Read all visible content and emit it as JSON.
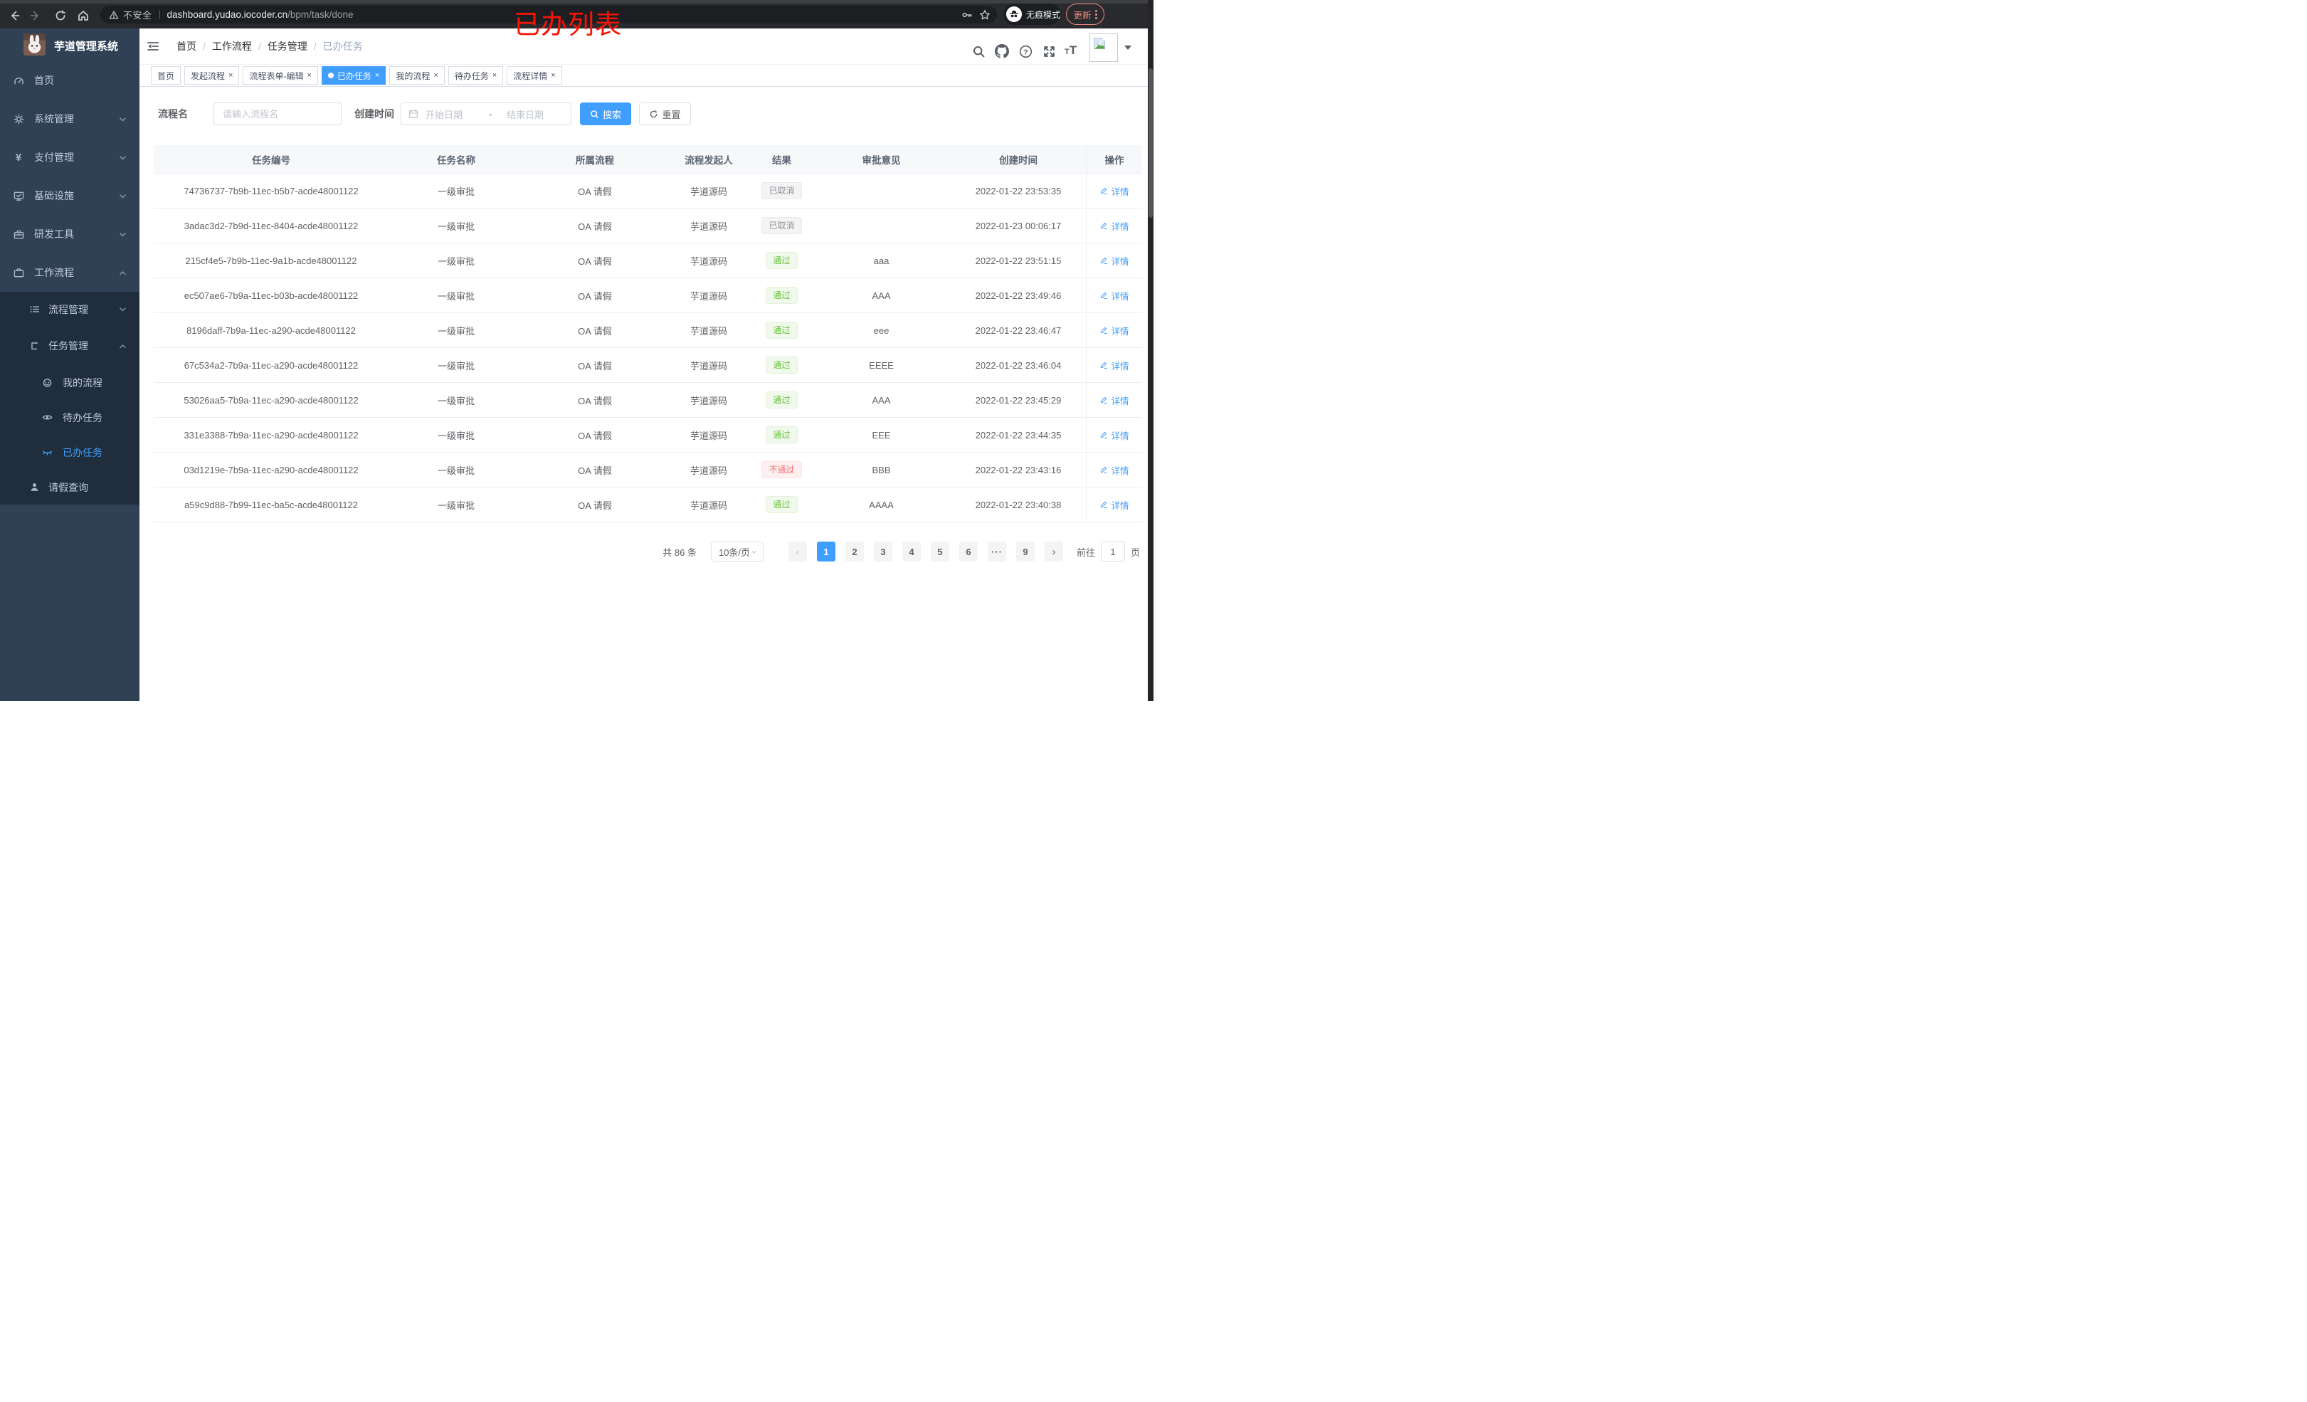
{
  "browser": {
    "security_label": "不安全",
    "url_host": "dashboard.yudao.iocoder.cn",
    "url_path": "/bpm/task/done",
    "incognito_label": "无痕模式",
    "update_label": "更新",
    "annotation_text": "已办列表",
    "annotation_color": "#fb1405",
    "nav_icons": [
      "back-icon",
      "forward-icon",
      "refresh-icon",
      "home-icon",
      "warning-icon",
      "key-icon",
      "star-icon",
      "incognito-icon",
      "kebab-menu-icon"
    ]
  },
  "sidebar": {
    "logo_title": "芋道管理系统",
    "items": [
      {
        "key": "home",
        "label": "首页",
        "icon": "dashboard",
        "level": 1,
        "group": "top"
      },
      {
        "key": "system",
        "label": "系统管理",
        "icon": "gear",
        "level": 1,
        "group": "top",
        "chevron": "down"
      },
      {
        "key": "payment",
        "label": "支付管理",
        "icon": "yen",
        "level": 1,
        "group": "top",
        "chevron": "down"
      },
      {
        "key": "infrastructure",
        "label": "基础设施",
        "icon": "monitor",
        "level": 1,
        "group": "top",
        "chevron": "down"
      },
      {
        "key": "devtools",
        "label": "研发工具",
        "icon": "toolbox",
        "level": 1,
        "group": "top",
        "chevron": "down"
      },
      {
        "key": "workflow",
        "label": "工作流程",
        "icon": "briefcase",
        "level": 1,
        "group": "top",
        "chevron": "up"
      },
      {
        "key": "process-mgmt",
        "label": "流程管理",
        "icon": "tree-list",
        "level": 2,
        "group": "sub",
        "chevron": "down"
      },
      {
        "key": "task-mgmt",
        "label": "任务管理",
        "icon": "flow",
        "level": 2,
        "group": "sub",
        "chevron": "up",
        "tall": true
      },
      {
        "key": "my-process",
        "label": "我的流程",
        "icon": "face",
        "level": 3,
        "group": "sub"
      },
      {
        "key": "todo-tasks",
        "label": "待办任务",
        "icon": "eye-open",
        "level": 3,
        "group": "sub"
      },
      {
        "key": "done-tasks",
        "label": "已办任务",
        "icon": "eye-closed",
        "level": 3,
        "group": "sub",
        "active": true
      },
      {
        "key": "leave-query",
        "label": "请假查询",
        "icon": "user",
        "level": 2,
        "group": "sub"
      }
    ]
  },
  "navbar": {
    "breadcrumb": [
      "首页",
      "工作流程",
      "任务管理",
      "已办任务"
    ],
    "separator": "/",
    "icons": [
      "hamburger-fold-icon",
      "search-icon",
      "github-icon",
      "question-icon",
      "fullscreen-icon",
      "text-size-icon",
      "avatar-placeholder",
      "caret-down-icon"
    ]
  },
  "tabs": [
    {
      "key": "home",
      "label": "首页",
      "closable": false,
      "active": false
    },
    {
      "key": "start-process",
      "label": "发起流程",
      "closable": true,
      "active": false
    },
    {
      "key": "form-edit",
      "label": "流程表单-编辑",
      "closable": true,
      "active": false
    },
    {
      "key": "done-tasks",
      "label": "已办任务",
      "closable": true,
      "active": true
    },
    {
      "key": "my-process",
      "label": "我的流程",
      "closable": true,
      "active": false
    },
    {
      "key": "todo-tasks",
      "label": "待办任务",
      "closable": true,
      "active": false
    },
    {
      "key": "process-detail",
      "label": "流程详情",
      "closable": true,
      "active": false
    }
  ],
  "filter": {
    "name_label": "流程名",
    "name_placeholder": "请输入流程名",
    "time_label": "创建时间",
    "start_placeholder": "开始日期",
    "range_separator": "-",
    "end_placeholder": "结束日期",
    "search_label": "搜索",
    "reset_label": "重置"
  },
  "table": {
    "columns": [
      "任务编号",
      "任务名称",
      "所属流程",
      "流程发起人",
      "结果",
      "审批意见",
      "创建时间",
      "操作"
    ],
    "action_label": "详情",
    "rows": [
      {
        "id": "74736737-7b9b-11ec-b5b7-acde48001122",
        "name": "一级审批",
        "process": "OA 请假",
        "starter": "芋道源码",
        "result": "已取消",
        "result_type": "info",
        "comment": "",
        "created": "2022-01-22 23:53:35"
      },
      {
        "id": "3adac3d2-7b9d-11ec-8404-acde48001122",
        "name": "一级审批",
        "process": "OA 请假",
        "starter": "芋道源码",
        "result": "已取消",
        "result_type": "info",
        "comment": "",
        "created": "2022-01-23 00:06:17"
      },
      {
        "id": "215cf4e5-7b9b-11ec-9a1b-acde48001122",
        "name": "一级审批",
        "process": "OA 请假",
        "starter": "芋道源码",
        "result": "通过",
        "result_type": "success",
        "comment": "aaa",
        "created": "2022-01-22 23:51:15"
      },
      {
        "id": "ec507ae6-7b9a-11ec-b03b-acde48001122",
        "name": "一级审批",
        "process": "OA 请假",
        "starter": "芋道源码",
        "result": "通过",
        "result_type": "success",
        "comment": "AAA",
        "created": "2022-01-22 23:49:46"
      },
      {
        "id": "8196daff-7b9a-11ec-a290-acde48001122",
        "name": "一级审批",
        "process": "OA 请假",
        "starter": "芋道源码",
        "result": "通过",
        "result_type": "success",
        "comment": "eee",
        "created": "2022-01-22 23:46:47"
      },
      {
        "id": "67c534a2-7b9a-11ec-a290-acde48001122",
        "name": "一级审批",
        "process": "OA 请假",
        "starter": "芋道源码",
        "result": "通过",
        "result_type": "success",
        "comment": "EEEE",
        "created": "2022-01-22 23:46:04"
      },
      {
        "id": "53026aa5-7b9a-11ec-a290-acde48001122",
        "name": "一级审批",
        "process": "OA 请假",
        "starter": "芋道源码",
        "result": "通过",
        "result_type": "success",
        "comment": "AAA",
        "created": "2022-01-22 23:45:29"
      },
      {
        "id": "331e3388-7b9a-11ec-a290-acde48001122",
        "name": "一级审批",
        "process": "OA 请假",
        "starter": "芋道源码",
        "result": "通过",
        "result_type": "success",
        "comment": "EEE",
        "created": "2022-01-22 23:44:35"
      },
      {
        "id": "03d1219e-7b9a-11ec-a290-acde48001122",
        "name": "一级审批",
        "process": "OA 请假",
        "starter": "芋道源码",
        "result": "不通过",
        "result_type": "danger",
        "comment": "BBB",
        "created": "2022-01-22 23:43:16"
      },
      {
        "id": "a59c9d88-7b99-11ec-ba5c-acde48001122",
        "name": "一级审批",
        "process": "OA 请假",
        "starter": "芋道源码",
        "result": "通过",
        "result_type": "success",
        "comment": "AAAA",
        "created": "2022-01-22 23:40:38"
      }
    ]
  },
  "pagination": {
    "total": "共 86 条",
    "page_size": "10条/页",
    "prev": "‹",
    "next": "›",
    "pages": [
      "1",
      "2",
      "3",
      "4",
      "5",
      "6",
      "···",
      "9"
    ],
    "active_page": "1",
    "goto_label": "前往",
    "goto_value": "1",
    "unit_label": "页"
  },
  "colors": {
    "accent": "#409eff",
    "success": "#67c23a",
    "danger": "#f56c6c",
    "info": "#909399",
    "sidebar_bg": "#304156",
    "submenu_bg": "#1f2d3d",
    "tag_active_bg": "#409eff"
  }
}
